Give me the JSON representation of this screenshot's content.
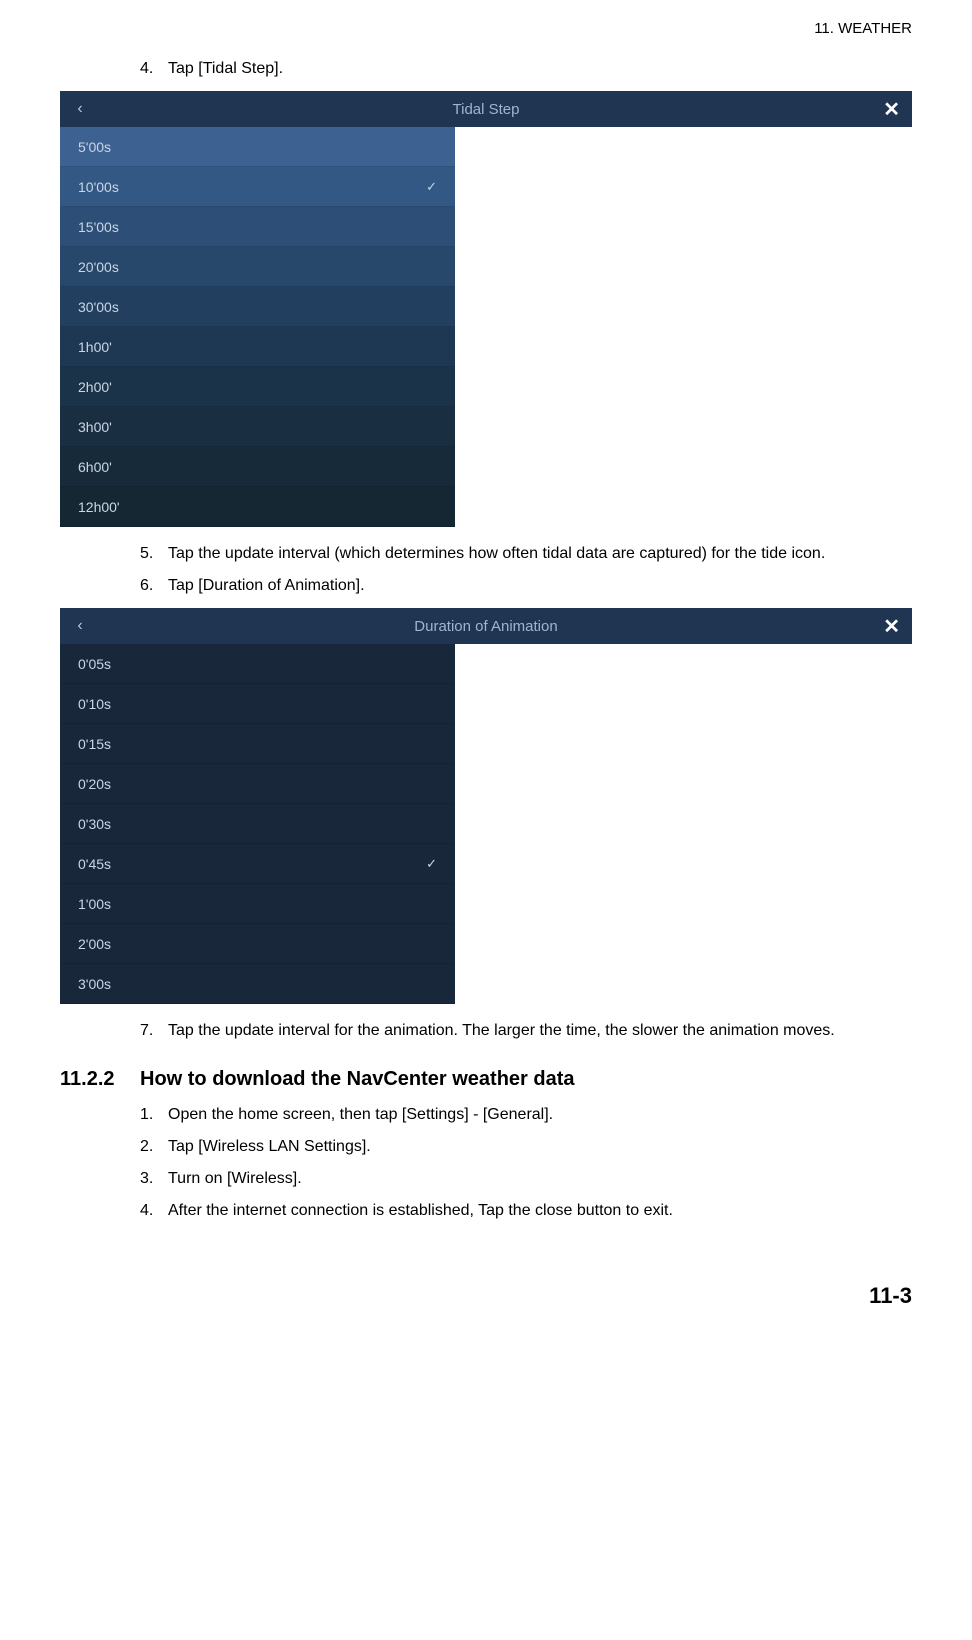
{
  "header": {
    "chapter_label": "11.  WEATHER"
  },
  "steps_a": [
    {
      "num": "4.",
      "text": "Tap [Tidal Step]."
    }
  ],
  "tidal_panel": {
    "title": "Tidal Step",
    "back": "‹",
    "close": "✕",
    "items": [
      {
        "label": "5'00s",
        "selected": false
      },
      {
        "label": "10'00s",
        "selected": true
      },
      {
        "label": "15'00s",
        "selected": false
      },
      {
        "label": "20'00s",
        "selected": false
      },
      {
        "label": "30'00s",
        "selected": false
      },
      {
        "label": "1h00'",
        "selected": false
      },
      {
        "label": "2h00'",
        "selected": false
      },
      {
        "label": "3h00'",
        "selected": false
      },
      {
        "label": "6h00'",
        "selected": false
      },
      {
        "label": "12h00'",
        "selected": false
      }
    ]
  },
  "steps_b": [
    {
      "num": "5.",
      "text": "Tap the update interval (which determines how often tidal data are captured) for the tide icon."
    },
    {
      "num": "6.",
      "text": "Tap [Duration of Animation]."
    }
  ],
  "duration_panel": {
    "title": "Duration of Animation",
    "back": "‹",
    "close": "✕",
    "items": [
      {
        "label": "0'05s",
        "selected": false
      },
      {
        "label": "0'10s",
        "selected": false
      },
      {
        "label": "0'15s",
        "selected": false
      },
      {
        "label": "0'20s",
        "selected": false
      },
      {
        "label": "0'30s",
        "selected": false
      },
      {
        "label": "0'45s",
        "selected": true
      },
      {
        "label": "1'00s",
        "selected": false
      },
      {
        "label": "2'00s",
        "selected": false
      },
      {
        "label": "3'00s",
        "selected": false
      }
    ]
  },
  "steps_c": [
    {
      "num": "7.",
      "text": "Tap the update interval for the animation. The larger the time, the slower the animation moves."
    }
  ],
  "section": {
    "number": "11.2.2",
    "title": "How to download the NavCenter weather data",
    "steps": [
      {
        "num": "1.",
        "text": "Open the home screen, then tap [Settings] - [General]."
      },
      {
        "num": "2.",
        "text": "Tap [Wireless LAN Settings]."
      },
      {
        "num": "3.",
        "text": "Turn on [Wireless]."
      },
      {
        "num": "4.",
        "text": "After the internet connection is established, Tap the close button to exit."
      }
    ]
  },
  "page_number": "11-3",
  "check_glyph": "✓"
}
